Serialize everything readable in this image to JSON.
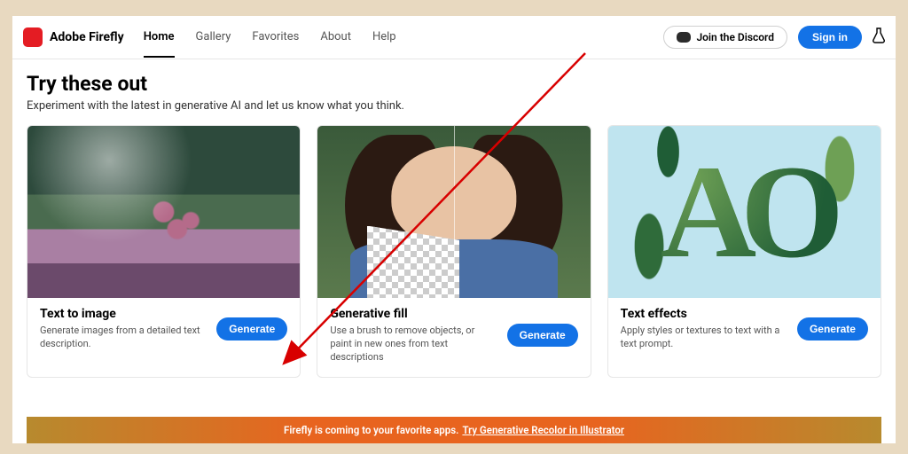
{
  "brand": "Adobe Firefly",
  "nav": {
    "home": "Home",
    "gallery": "Gallery",
    "favorites": "Favorites",
    "about": "About",
    "help": "Help"
  },
  "header": {
    "discord": "Join the Discord",
    "signin": "Sign in"
  },
  "hero": {
    "title": "Try these out",
    "subtitle": "Experiment with the latest in generative AI and let us know what you think."
  },
  "cards": [
    {
      "title": "Text to image",
      "desc": "Generate images from a detailed text description.",
      "cta": "Generate"
    },
    {
      "title": "Generative fill",
      "desc": "Use a brush to remove objects, or paint in new ones from text descriptions",
      "cta": "Generate"
    },
    {
      "title": "Text effects",
      "desc": "Apply styles or textures to text with a text prompt.",
      "cta": "Generate"
    }
  ],
  "banner": {
    "text": "Firefly is coming to your favorite apps.",
    "link": "Try Generative Recolor in Illustrator"
  }
}
